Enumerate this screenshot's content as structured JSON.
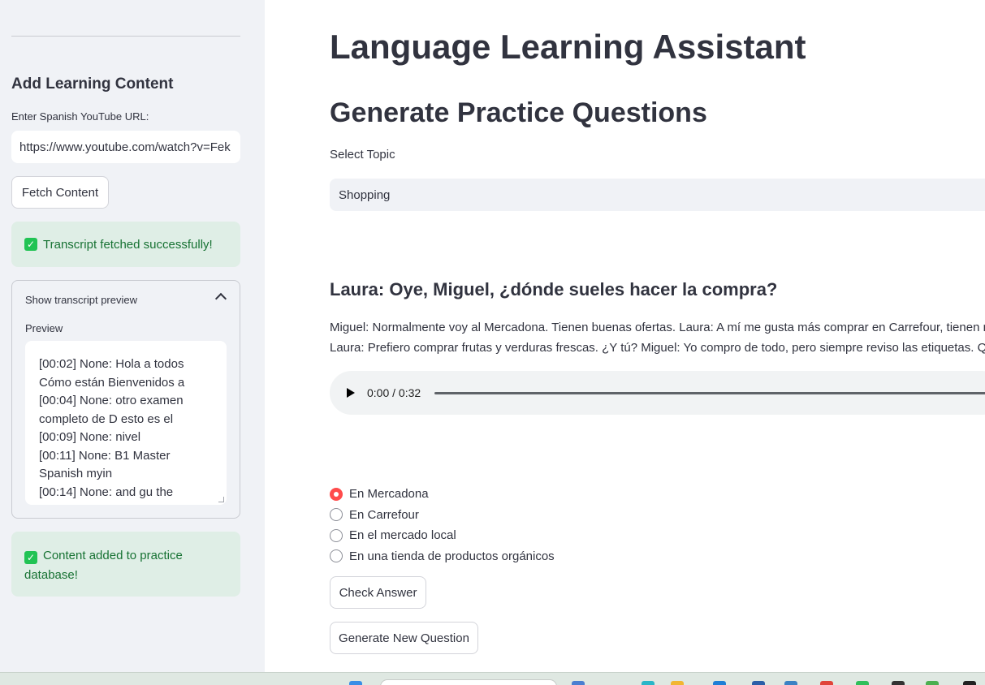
{
  "sidebar": {
    "heading": "Add Learning Content",
    "url_label": "Enter Spanish YouTube URL:",
    "url_value": "https://www.youtube.com/watch?v=Fek",
    "fetch_button": "Fetch Content",
    "fetch_success": "Transcript fetched successfully!",
    "expander": {
      "title": "Show transcript preview",
      "preview_label": "Preview",
      "lines": [
        "[00:02] None: Hola a todos",
        "Cómo están Bienvenidos a",
        "[00:04] None: otro examen",
        "completo de D esto es el",
        "[00:09] None: nivel",
        "[00:11] None: B1 Master",
        "Spanish myin",
        "[00:14] None: and gu the"
      ]
    },
    "added_success": "Content added to practice database!"
  },
  "main": {
    "title": "Language Learning Assistant",
    "section_title": "Generate Practice Questions",
    "select_label": "Select Topic",
    "select_value": "Shopping",
    "question": "Laura: Oye, Miguel, ¿dónde sueles hacer la compra?",
    "dialogue_line1": "Miguel: Normalmente voy al Mercadona. Tienen buenas ofertas. Laura: A mí me gusta más comprar en Carrefour, tienen m",
    "dialogue_line2": "Laura: Prefiero comprar frutas y verduras frescas. ¿Y tú? Miguel: Yo compro de todo, pero siempre reviso las etiquetas. Quie",
    "audio_time": "0:00 / 0:32",
    "options": [
      {
        "label": "En Mercadona",
        "selected": true
      },
      {
        "label": "En Carrefour",
        "selected": false
      },
      {
        "label": "En el mercado local",
        "selected": false
      },
      {
        "label": "En una tienda de productos orgánicos",
        "selected": false
      }
    ],
    "check_button": "Check Answer",
    "generate_button": "Generate New Question"
  },
  "colors": {
    "accent": "#ff4b4b",
    "success_bg": "#dfeee6",
    "success_text": "#177233",
    "sidebar_bg": "#f0f2f6"
  }
}
